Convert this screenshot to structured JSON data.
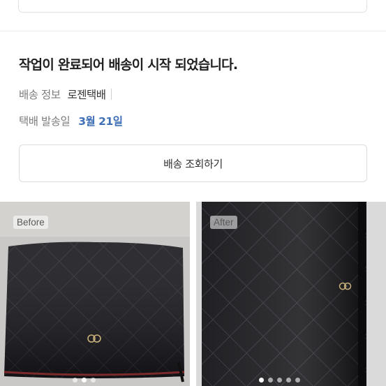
{
  "delivery": {
    "status_message": "작업이 완료되어 배송이 시작 되었습니다.",
    "shipping_info_label": "배송 정보",
    "carrier": "로젠택배",
    "ship_date_label": "택배 발송일",
    "ship_date": "3월 21일",
    "track_button_label": "배송 조회하기"
  },
  "photos": [
    {
      "tag": "Before",
      "dot_count": 3,
      "active_dot": 1
    },
    {
      "tag": "After",
      "dot_count": 5,
      "active_dot": 0
    }
  ],
  "colors": {
    "date_accent": "#3f6fb5",
    "label_gray": "#7d7d7d",
    "border": "#dcdcdc"
  }
}
